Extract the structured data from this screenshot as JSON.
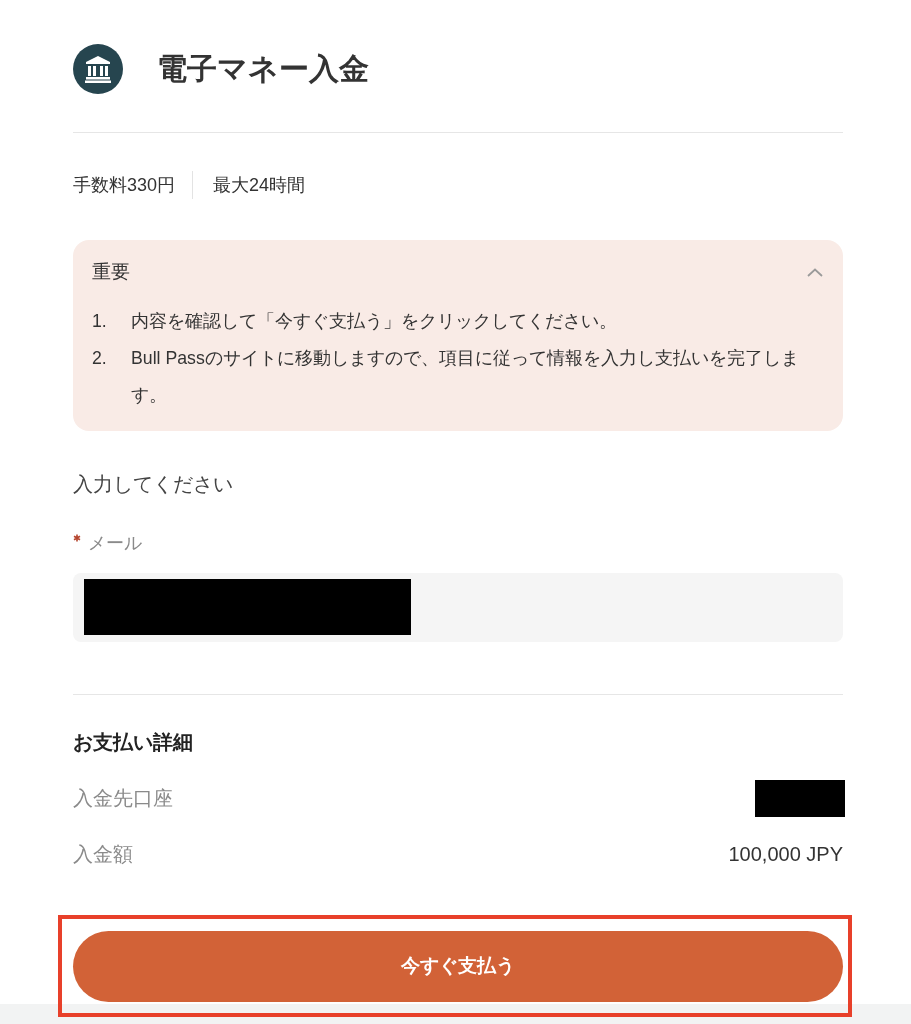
{
  "header": {
    "title": "電子マネー入金"
  },
  "summary": [
    "手数料330円",
    "最大24時間"
  ],
  "notice": {
    "title": "重要",
    "expanded": true,
    "items": [
      {
        "number": "1.",
        "text": "内容を確認して「今すぐ支払う」をクリックしてください。"
      },
      {
        "number": "2.",
        "text": "Bull Passのサイトに移動しますので、項目に従って情報を入力し支払いを完了します。"
      }
    ]
  },
  "form": {
    "heading": "入力してください",
    "fields": [
      {
        "label": "メール",
        "required": true,
        "redacted": true
      }
    ]
  },
  "payment_details": {
    "title": "お支払い詳細",
    "rows": [
      {
        "label": "入金先口座",
        "redacted": true
      },
      {
        "label": "入金額",
        "redacted": false,
        "value": "100,000 JPY"
      }
    ]
  },
  "pay_button": {
    "label": "今すぐ支払う",
    "highlighted": true
  }
}
